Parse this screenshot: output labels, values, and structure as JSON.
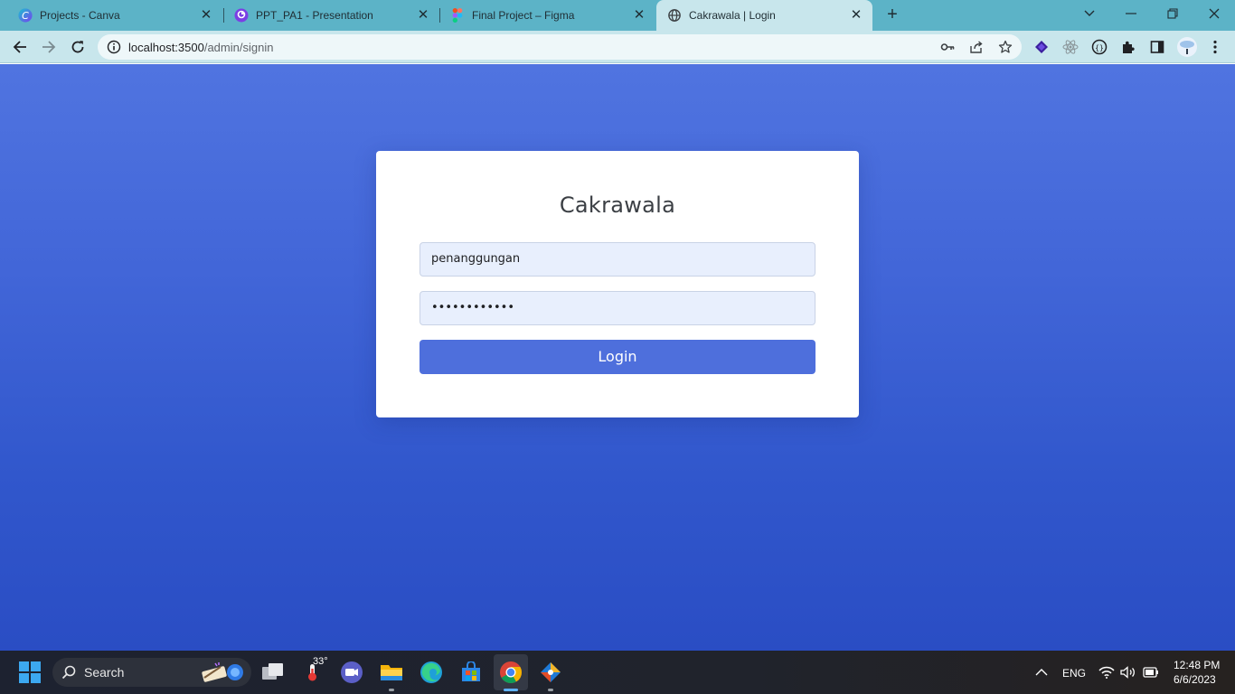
{
  "tabs": [
    {
      "title": "Projects - Canva",
      "favicon": "canva-icon"
    },
    {
      "title": "PPT_PA1 - Presentation",
      "favicon": "presentation-icon"
    },
    {
      "title": "Final Project – Figma",
      "favicon": "figma-icon"
    },
    {
      "title": "Cakrawala | Login",
      "favicon": "globe-icon",
      "active": true
    }
  ],
  "toolbar": {
    "url_host": "localhost:3500",
    "url_path": "/admin/signin"
  },
  "login": {
    "title": "Cakrawala",
    "username": "penanggungan",
    "password_masked": "••••••••••••",
    "button_label": "Login"
  },
  "taskbar": {
    "search_label": "Search",
    "weather_temp": "33°",
    "language": "ENG",
    "time": "12:48 PM",
    "date": "6/6/2023"
  },
  "colors": {
    "tabstrip": "#5cb3c7",
    "toolbar": "#c8e6ec",
    "page_background": "#4266d8",
    "login_button": "#4e6fdc",
    "input_background": "#e8effd"
  }
}
